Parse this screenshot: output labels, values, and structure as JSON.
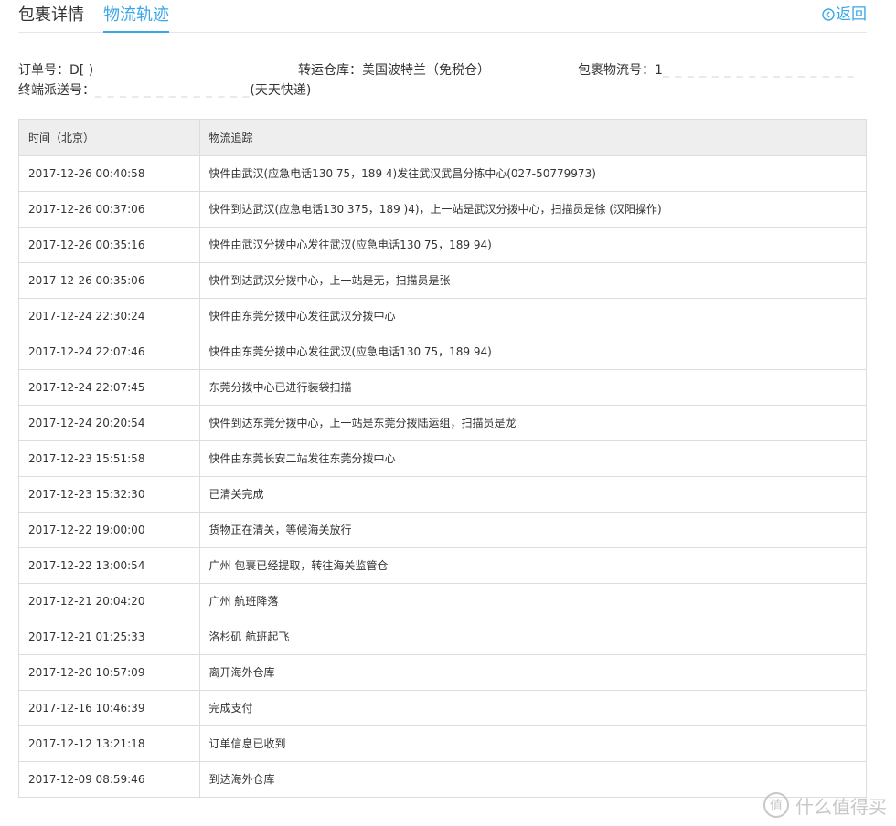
{
  "tabs": [
    {
      "label": "包裹详情"
    },
    {
      "label": "物流轨迹"
    }
  ],
  "back_label": "返回",
  "info": {
    "order_label": "订单号：",
    "order_value": "D[                    )",
    "warehouse_label": "转运仓库：",
    "warehouse_value": "美国波特兰（免税仓）",
    "tracking_label": "包裹物流号：",
    "tracking_value": "1",
    "final_label": "终端派送号：",
    "final_value": "(天天快递)"
  },
  "table": {
    "headers": [
      "时间（北京）",
      "物流追踪"
    ],
    "rows": [
      [
        "2017-12-26 00:40:58",
        "快件由武汉(应急电话130          75，189          4)发往武汉武昌分拣中心(027-50779973)"
      ],
      [
        "2017-12-26 00:37:06",
        "快件到达武汉(应急电话130          375，189          )4)，上一站是武汉分拨中心，扫描员是徐     (汉阳操作)"
      ],
      [
        "2017-12-26 00:35:16",
        "快件由武汉分拨中心发往武汉(应急电话130          75，189          94)"
      ],
      [
        "2017-12-26 00:35:06",
        "快件到达武汉分拨中心，上一站是无，扫描员是张"
      ],
      [
        "2017-12-24 22:30:24",
        "快件由东莞分拨中心发往武汉分拨中心"
      ],
      [
        "2017-12-24 22:07:46",
        "快件由东莞分拨中心发往武汉(应急电话130          75，189          94)"
      ],
      [
        "2017-12-24 22:07:45",
        "东莞分拨中心已进行装袋扫描"
      ],
      [
        "2017-12-24 20:20:54",
        "快件到达东莞分拨中心，上一站是东莞分拨陆运组，扫描员是龙"
      ],
      [
        "2017-12-23 15:51:58",
        "快件由东莞长安二站发往东莞分拨中心"
      ],
      [
        "2017-12-23 15:32:30",
        "已清关完成"
      ],
      [
        "2017-12-22 19:00:00",
        "货物正在清关，等候海关放行"
      ],
      [
        "2017-12-22 13:00:54",
        "广州 包裹已经提取，转往海关监管仓"
      ],
      [
        "2017-12-21 20:04:20",
        "广州 航班降落"
      ],
      [
        "2017-12-21 01:25:33",
        "洛杉矶 航班起飞"
      ],
      [
        "2017-12-20 10:57:09",
        "离开海外仓库"
      ],
      [
        "2017-12-16 10:46:39",
        "完成支付"
      ],
      [
        "2017-12-12 13:21:18",
        "订单信息已收到"
      ],
      [
        "2017-12-09 08:59:46",
        "到达海外仓库"
      ]
    ]
  },
  "watermark_text": "什么值得买",
  "colors": {
    "accent": "#3aa7e8",
    "header_bg": "#eeeeee",
    "border": "#dddddd"
  }
}
